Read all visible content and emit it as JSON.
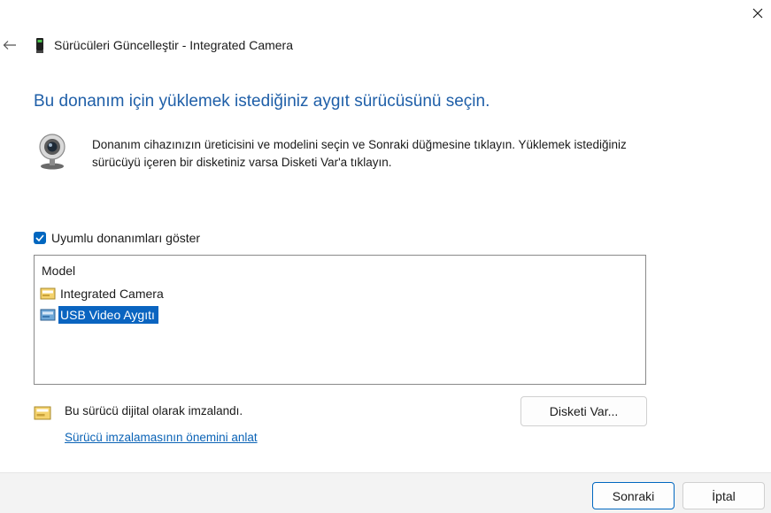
{
  "window": {
    "title": "Sürücüleri Güncelleştir - Integrated Camera",
    "close_icon": "close-icon",
    "back_icon": "back-arrow-icon"
  },
  "main": {
    "heading": "Bu donanım için yüklemek istediğiniz aygıt sürücüsünü seçin.",
    "instruction": "Donanım cihazınızın üreticisini ve modelini seçin ve Sonraki düğmesine tıklayın. Yüklemek istediğiniz sürücüyü içeren bir disketiniz varsa Disketi Var'a tıklayın.",
    "device_icon": "webcam-icon"
  },
  "compatible": {
    "label": "Uyumlu donanımları göster",
    "checked": true
  },
  "model_list": {
    "header": "Model",
    "items": [
      {
        "label": "Integrated Camera",
        "selected": false
      },
      {
        "label": "USB Video Aygıtı",
        "selected": true
      }
    ]
  },
  "signature": {
    "text": "Bu sürücü dijital olarak imzalandı.",
    "link": "Sürücü imzalamasının önemini anlat"
  },
  "buttons": {
    "have_disk": "Disketi Var...",
    "next": "Sonraki",
    "cancel": "İptal"
  },
  "colors": {
    "heading": "#1f5fa8",
    "accent": "#0067c0",
    "selection": "#0a64c0",
    "link": "#0b63b6"
  }
}
